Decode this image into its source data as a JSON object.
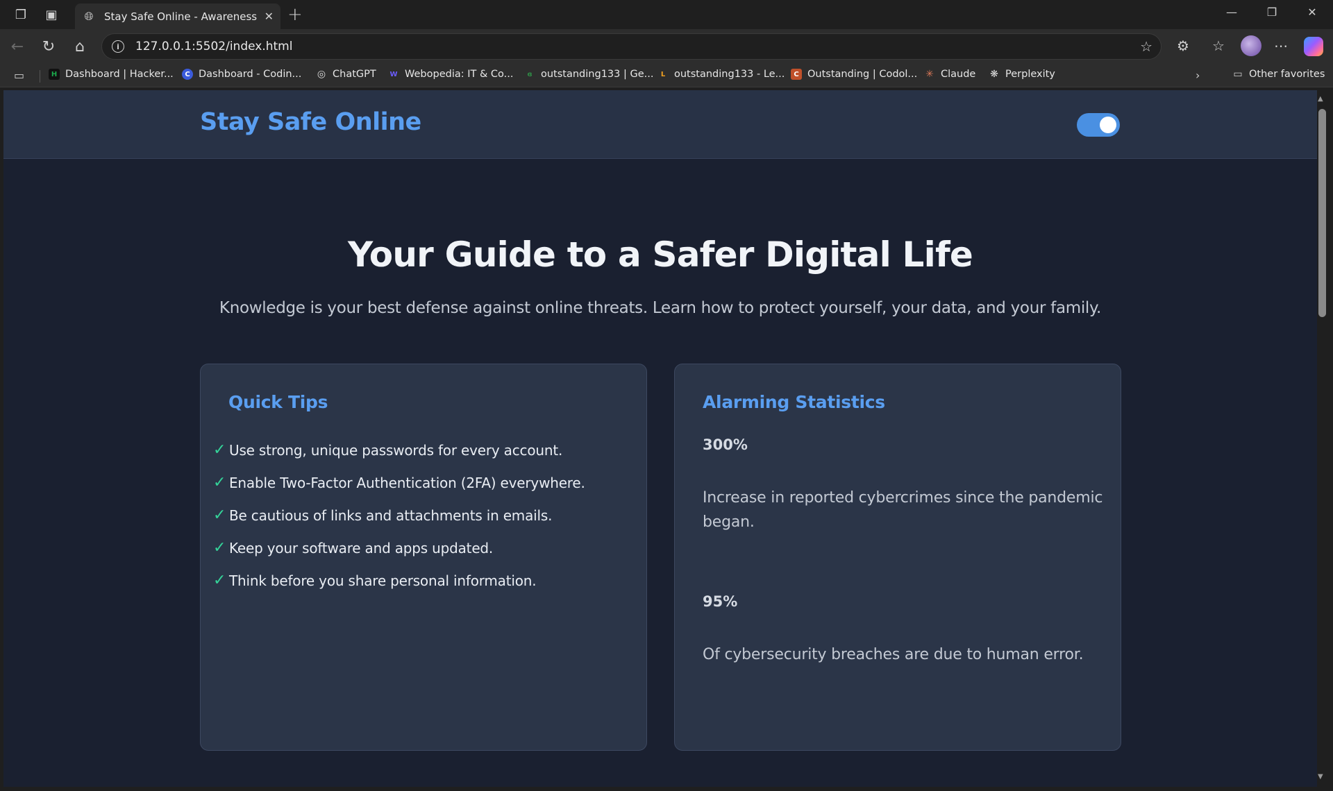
{
  "browser": {
    "tab_title": "Stay Safe Online - Awareness Cam",
    "url": "127.0.0.1:5502/index.html",
    "bookmarks": [
      {
        "label": "Dashboard | Hacker...",
        "color": "#1ba94c",
        "glyph": "H"
      },
      {
        "label": "Dashboard - Codin...",
        "color": "#3b5bdb",
        "glyph": "C"
      },
      {
        "label": "ChatGPT",
        "color": "#444444",
        "glyph": "◎"
      },
      {
        "label": "Webopedia: IT & Co...",
        "color": "#4a3fd6",
        "glyph": "W"
      },
      {
        "label": "outstanding133 | Ge...",
        "color": "#2f8d46",
        "glyph": "G"
      },
      {
        "label": "outstanding133 - Le...",
        "color": "#f0a020",
        "glyph": "L"
      },
      {
        "label": "Outstanding | Codol...",
        "color": "#c0502a",
        "glyph": "C"
      },
      {
        "label": "Claude",
        "color": "#d97757",
        "glyph": "✳"
      },
      {
        "label": "Perplexity",
        "color": "#3a3a3a",
        "glyph": "❋"
      }
    ],
    "other_favorites": "Other favorites"
  },
  "site": {
    "title": "Stay Safe Online",
    "theme_toggle_on": true,
    "accent_color": "#4a90e2"
  },
  "hero": {
    "title": "Your Guide to a Safer Digital Life",
    "subtitle": "Knowledge is your best defense against online threats. Learn how to protect yourself, your data, and your family."
  },
  "tips_card": {
    "title": "Quick Tips",
    "check": "✓",
    "items": [
      "Use strong, unique passwords for every account.",
      "Enable Two-Factor Authentication (2FA) everywhere.",
      "Be cautious of links and attachments in emails.",
      "Keep your software and apps updated.",
      "Think before you share personal information."
    ]
  },
  "stats_card": {
    "title": "Alarming Statistics",
    "stats": [
      {
        "value": "300%",
        "description": "Increase in reported cybercrimes since the pandemic began."
      },
      {
        "value": "95%",
        "description": "Of cybersecurity breaches are due to human error."
      }
    ]
  }
}
